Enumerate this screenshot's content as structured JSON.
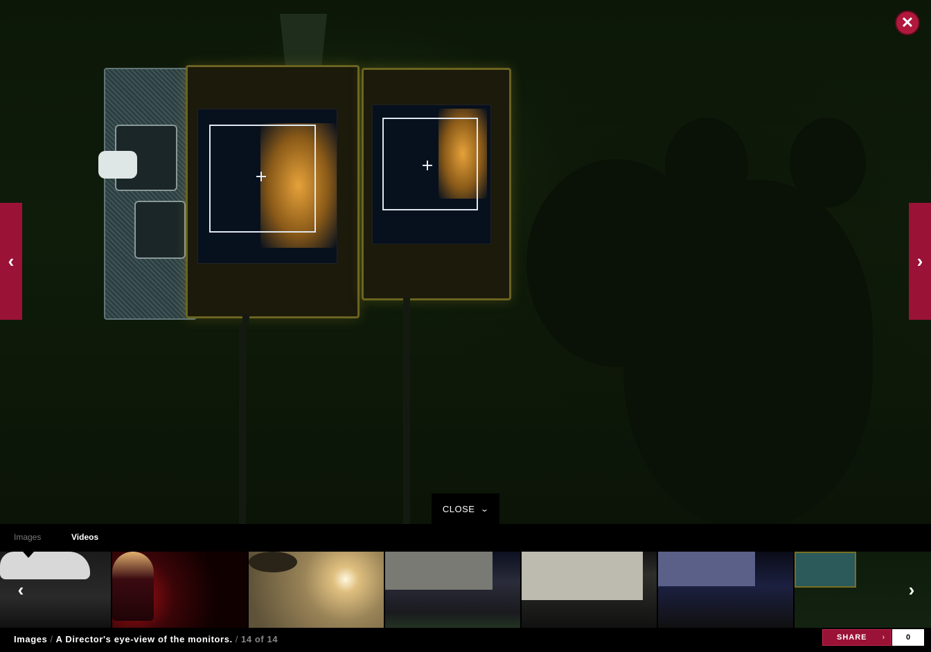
{
  "viewer": {
    "caption": "A Director's eye-view of the monitors.",
    "section": "Images",
    "counter": "14 of 14",
    "close_label": "CLOSE"
  },
  "tabs": [
    {
      "label": "Images"
    },
    {
      "label": "Videos"
    }
  ],
  "thumbnails": [
    {
      "subject": "white sports car at night"
    },
    {
      "subject": "woman in red light"
    },
    {
      "subject": "helicopter in sunset haze"
    },
    {
      "subject": "helicopter in front of mansion"
    },
    {
      "subject": "mansion facade at night"
    },
    {
      "subject": "mansion under floodlights"
    },
    {
      "subject": "camera monitors"
    }
  ],
  "share": {
    "label": "SHARE",
    "count": "0"
  },
  "icons": {
    "close": "close-x-icon",
    "prev": "chevron-left-icon",
    "next": "chevron-right-icon",
    "collapse": "chevron-down-icon"
  },
  "colors": {
    "accent": "#9a1236",
    "close_button": "#b0183c"
  }
}
